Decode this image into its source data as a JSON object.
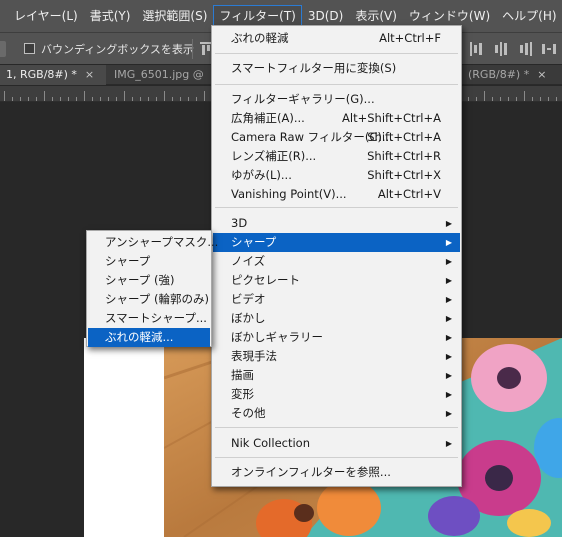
{
  "menubar": {
    "items": [
      {
        "label": "レイヤー(L)"
      },
      {
        "label": "書式(Y)"
      },
      {
        "label": "選択範囲(S)"
      },
      {
        "label": "フィルター(T)"
      },
      {
        "label": "3D(D)"
      },
      {
        "label": "表示(V)"
      },
      {
        "label": "ウィンドウ(W)"
      },
      {
        "label": "ヘルプ(H)"
      }
    ]
  },
  "options": {
    "checkbox_label": "バウンディングボックスを表示"
  },
  "tabs": [
    {
      "label": "1, RGB/8#) *",
      "close": "×"
    },
    {
      "label": "IMG_6501.jpg @",
      "close": ""
    },
    {
      "label": "(RGB/8#) *",
      "close": "×"
    }
  ],
  "filter_menu": {
    "items": [
      {
        "label": "ぶれの軽減",
        "shortcut": "Alt+Ctrl+F"
      },
      {
        "label": "スマートフィルター用に変換(S)",
        "shortcut": ""
      },
      {
        "label": "フィルターギャラリー(G)...",
        "shortcut": ""
      },
      {
        "label": "広角補正(A)...",
        "shortcut": "Alt+Shift+Ctrl+A"
      },
      {
        "label": "Camera Raw フィルター(C)...",
        "shortcut": "Shift+Ctrl+A"
      },
      {
        "label": "レンズ補正(R)...",
        "shortcut": "Shift+Ctrl+R"
      },
      {
        "label": "ゆがみ(L)...",
        "shortcut": "Shift+Ctrl+X"
      },
      {
        "label": "Vanishing Point(V)...",
        "shortcut": "Alt+Ctrl+V"
      },
      {
        "label": "3D",
        "shortcut": ""
      },
      {
        "label": "シャープ",
        "shortcut": ""
      },
      {
        "label": "ノイズ",
        "shortcut": ""
      },
      {
        "label": "ピクセレート",
        "shortcut": ""
      },
      {
        "label": "ビデオ",
        "shortcut": ""
      },
      {
        "label": "ぼかし",
        "shortcut": ""
      },
      {
        "label": "ぼかしギャラリー",
        "shortcut": ""
      },
      {
        "label": "表現手法",
        "shortcut": ""
      },
      {
        "label": "描画",
        "shortcut": ""
      },
      {
        "label": "変形",
        "shortcut": ""
      },
      {
        "label": "その他",
        "shortcut": ""
      },
      {
        "label": "Nik Collection",
        "shortcut": ""
      },
      {
        "label": "オンラインフィルターを参照...",
        "shortcut": ""
      }
    ],
    "submenu_arrow": "▶"
  },
  "sharpen_menu": {
    "items": [
      {
        "label": "アンシャープマスク..."
      },
      {
        "label": "シャープ"
      },
      {
        "label": "シャープ (強)"
      },
      {
        "label": "シャープ (輪郭のみ)"
      },
      {
        "label": "スマートシャープ..."
      },
      {
        "label": "ぶれの軽減..."
      }
    ]
  },
  "colors": {
    "menu_highlight": "#0b63c4",
    "menubar_bg": "#535353",
    "menu_bg": "#f2f2f2"
  }
}
